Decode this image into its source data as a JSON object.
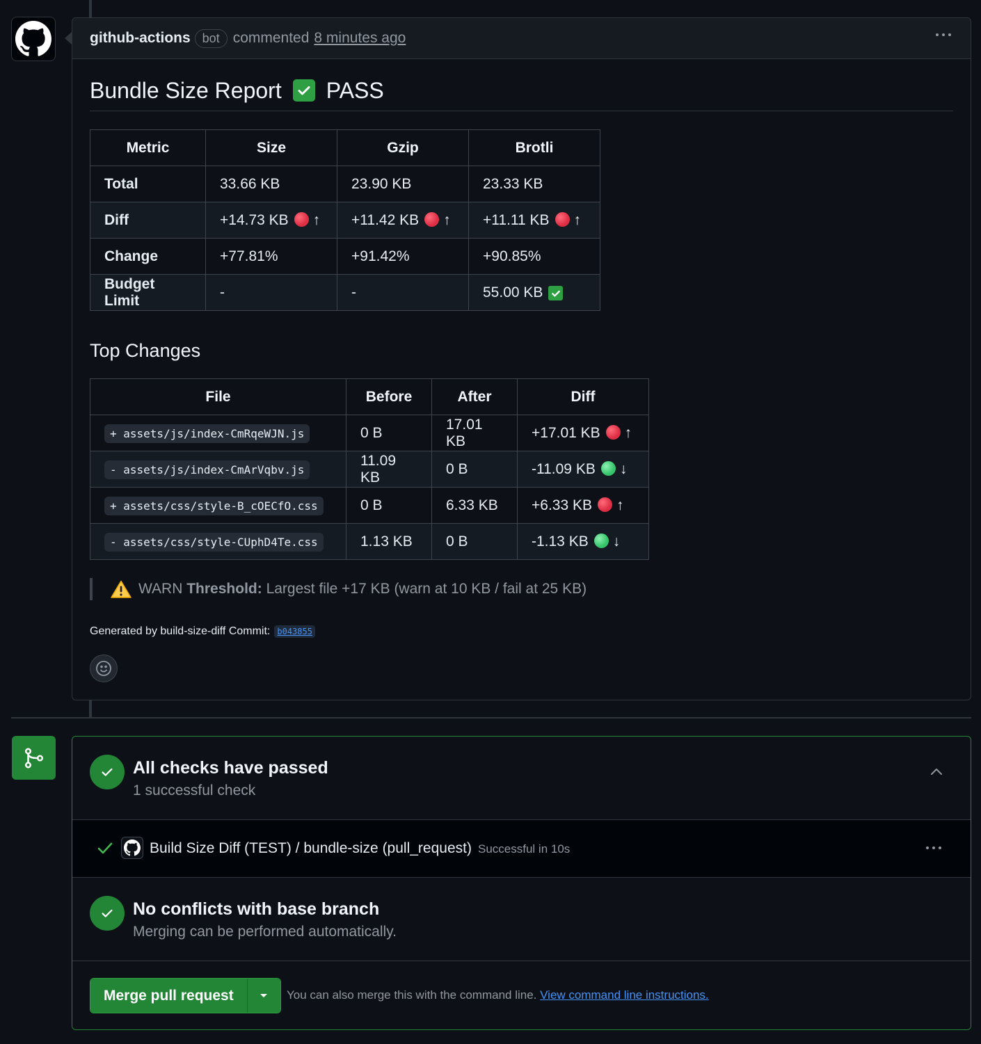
{
  "comment": {
    "author": "github-actions",
    "badge": "bot",
    "action": "commented",
    "time": "8 minutes ago",
    "title": "Bundle Size Report",
    "title_status": "PASS",
    "metrics_table": {
      "headers": [
        "Metric",
        "Size",
        "Gzip",
        "Brotli"
      ],
      "rows": [
        {
          "metric": "Total",
          "size": "33.66 KB",
          "gzip": "23.90 KB",
          "brotli": "23.33 KB"
        },
        {
          "metric": "Diff",
          "size": "+14.73 KB",
          "gzip": "+11.42 KB",
          "brotli": "+11.11 KB"
        },
        {
          "metric": "Change",
          "size": "+77.81%",
          "gzip": "+91.42%",
          "brotli": "+90.85%"
        },
        {
          "metric": "Budget Limit",
          "size": "-",
          "gzip": "-",
          "brotli": "55.00 KB"
        }
      ],
      "arrow_up": "↑"
    },
    "top_changes_title": "Top Changes",
    "files_table": {
      "headers": [
        "File",
        "Before",
        "After",
        "Diff"
      ],
      "rows": [
        {
          "file": "+ assets/js/index-CmRqeWJN.js",
          "before": "0 B",
          "after": "17.01 KB",
          "diff": "+17.01 KB",
          "arrow": "↑"
        },
        {
          "file": "- assets/js/index-CmArVqbv.js",
          "before": "11.09 KB",
          "after": "0 B",
          "diff": "-11.09 KB",
          "arrow": "↓"
        },
        {
          "file": "+ assets/css/style-B_cOECfO.css",
          "before": "0 B",
          "after": "6.33 KB",
          "diff": "+6.33 KB",
          "arrow": "↑"
        },
        {
          "file": "- assets/css/style-CUphD4Te.css",
          "before": "1.13 KB",
          "after": "0 B",
          "diff": "-1.13 KB",
          "arrow": "↓"
        }
      ]
    },
    "warning": {
      "level": "WARN",
      "label": "Threshold:",
      "text": "Largest file +17 KB (warn at 10 KB / fail at 25 KB)"
    },
    "footer_text": "Generated by build-size-diff Commit:",
    "commit_sha": "b043855"
  },
  "merge_box": {
    "checks_title": "All checks have passed",
    "checks_sub": "1 successful check",
    "check_name": "Build Size Diff (TEST) / bundle-size (pull_request)",
    "check_status": "Successful in 10s",
    "conflicts_title": "No conflicts with base branch",
    "conflicts_sub": "Merging can be performed automatically.",
    "merge_button": "Merge pull request",
    "hint": "You can also merge this with the command line.",
    "hint_link": "View command line instructions."
  },
  "colors": {
    "background": "#0d1117",
    "border": "#30363d",
    "success": "#238636",
    "link": "#4493f8"
  }
}
